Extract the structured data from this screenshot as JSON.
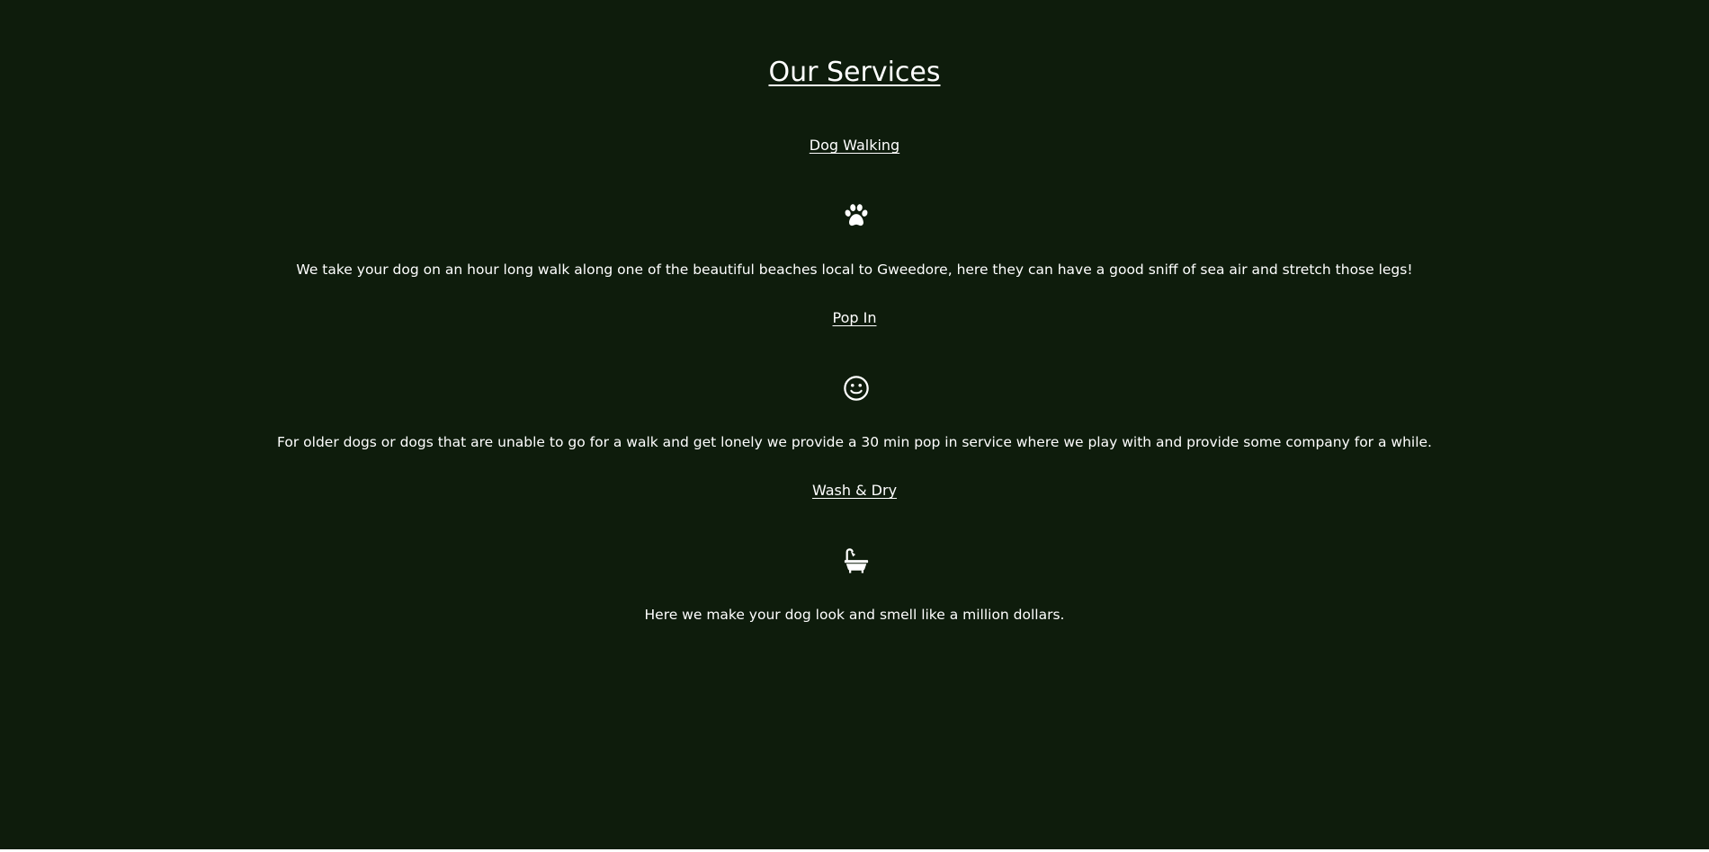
{
  "heading": "Our Services",
  "services": [
    {
      "title": "Dog Walking",
      "icon": "paw-icon",
      "description": "We take your dog on an hour long walk along one of the beautiful beaches local to Gweedore, here they can have a good sniff of sea air and stretch those legs!"
    },
    {
      "title": "Pop In",
      "icon": "smiley-face-icon",
      "description": "For older dogs or dogs that are unable to go for a walk and get lonely we provide a 30 min pop in service where we play with and provide some company for a while."
    },
    {
      "title": "Wash & Dry",
      "icon": "bathtub-icon",
      "description": "Here we make your dog look and smell like a million dollars."
    }
  ],
  "colors": {
    "background": "#0e1c0c",
    "text": "#ffffff"
  }
}
